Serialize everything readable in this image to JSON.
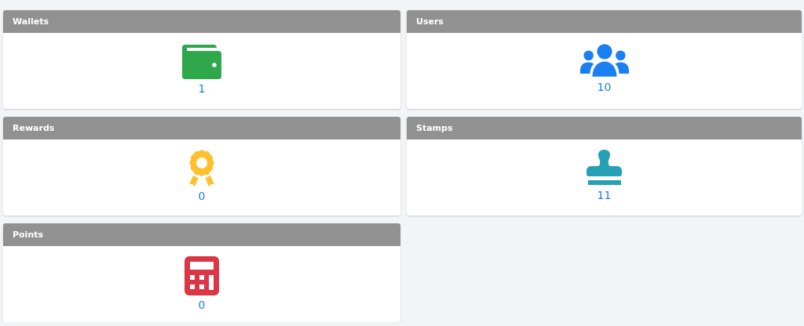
{
  "cards": [
    {
      "title": "Wallets",
      "kind": "wallet",
      "count": "1"
    },
    {
      "title": "Users",
      "kind": "users",
      "count": "10"
    },
    {
      "title": "Rewards",
      "kind": "award",
      "count": "0"
    },
    {
      "title": "Stamps",
      "kind": "stamp",
      "count": "11"
    },
    {
      "title": "Points",
      "kind": "calculator",
      "count": "0"
    }
  ]
}
